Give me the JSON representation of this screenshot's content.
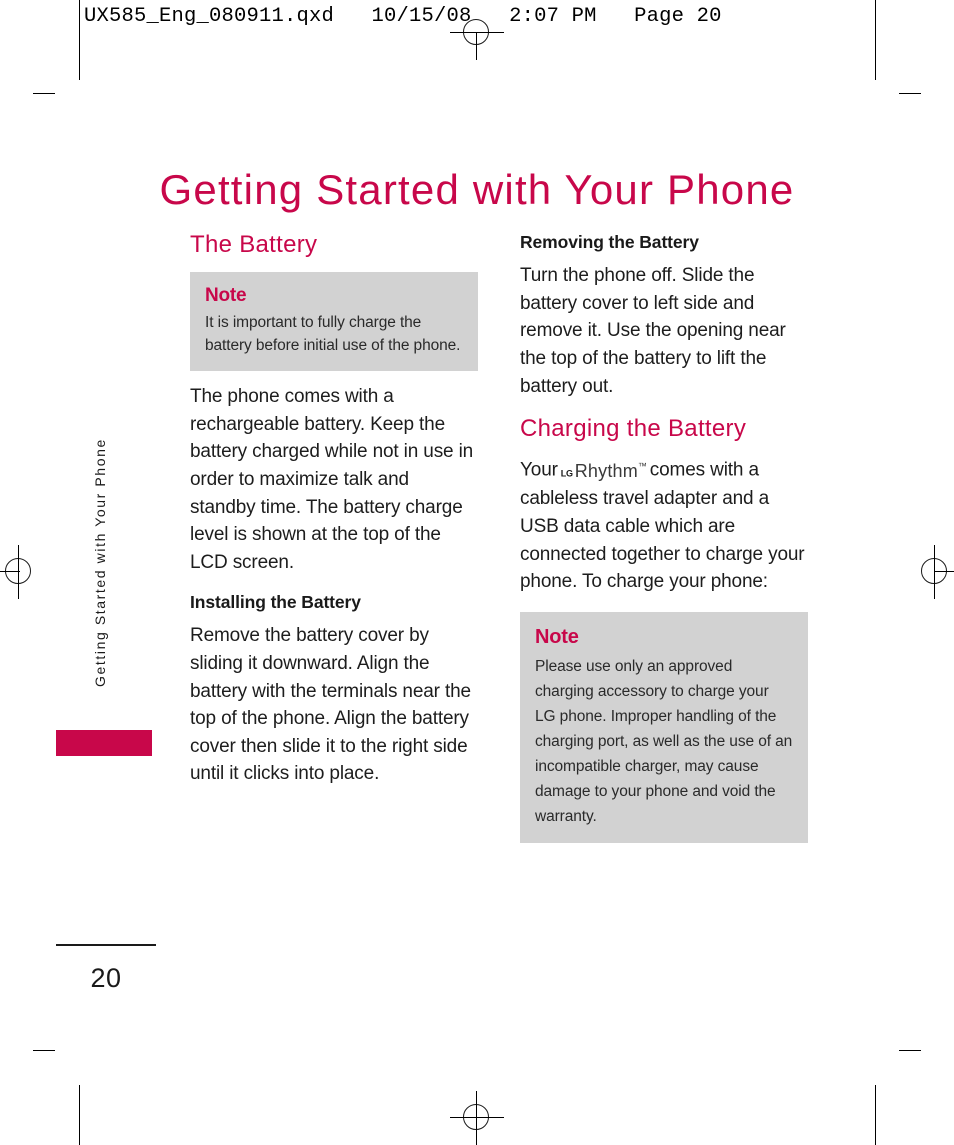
{
  "print_header": "UX585_Eng_080911.qxd   10/15/08   2:07 PM   Page 20",
  "page_title": "Getting Started with Your Phone",
  "running_head": "Getting Started with Your Phone",
  "page_number": "20",
  "accent_color": "#c8074a",
  "note_background": "#d2d2d2",
  "left_column": {
    "section_title": "The Battery",
    "note": {
      "title": "Note",
      "text": "It is important to fully charge the battery before initial use of the phone."
    },
    "intro_paragraph": "The phone comes with a rechargeable battery. Keep the battery charged while not in use in order to maximize talk and standby time. The battery charge level is shown at the top of the LCD screen.",
    "installing_heading": "Installing the Battery",
    "installing_paragraph": "Remove the battery cover by sliding it downward. Align the battery with the terminals near the top of the phone. Align the battery cover then slide it to the right side until it clicks into place."
  },
  "right_column": {
    "removing_heading": "Removing the Battery",
    "removing_paragraph": "Turn the phone off. Slide the battery cover to left side and remove it. Use the opening near the top of the battery to lift the battery out.",
    "charging_heading": "Charging the Battery",
    "charging_paragraph_before": "Your",
    "brand_lg": "LG",
    "brand_model": "Rhythm",
    "brand_tm": "™",
    "charging_paragraph_after": "comes with a cableless travel adapter and a USB data cable which are connected together to charge your phone. To charge your phone:",
    "note": {
      "title": "Note",
      "text": "Please use only an approved charging accessory to charge your LG phone. Improper handling of the charging port, as well as the use of an incompatible charger, may cause damage to your phone and void  the warranty."
    }
  }
}
